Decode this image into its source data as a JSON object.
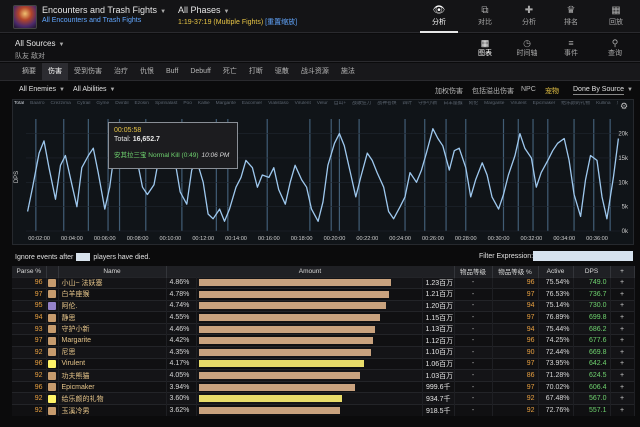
{
  "header": {
    "title": "Encounters and Trash Fights",
    "subtitle": "All Encounters and Trash Fights",
    "phase": "All Phases",
    "phase_time": "1:19-37:19 (Multiple Fights)",
    "phase_reset": "[重置缩放]",
    "tabs": [
      {
        "label": "分析",
        "icon": "eye-icon",
        "glyph": "👁"
      },
      {
        "label": "对比",
        "icon": "compare-icon",
        "glyph": "⧉"
      },
      {
        "label": "分析",
        "icon": "puzzle-icon",
        "glyph": "✚"
      },
      {
        "label": "排名",
        "icon": "trophy-icon",
        "glyph": "♛"
      },
      {
        "label": "回放",
        "icon": "replay-icon",
        "glyph": "▦"
      }
    ]
  },
  "sources": {
    "label": "All Sources",
    "sub": "队友  敌对"
  },
  "view_tabs": [
    {
      "label": "图表",
      "icon": "grid-icon",
      "glyph": "▦"
    },
    {
      "label": "时间轴",
      "icon": "clock-icon",
      "glyph": "◷"
    },
    {
      "label": "事件",
      "icon": "list-icon",
      "glyph": "≡"
    },
    {
      "label": "查询",
      "icon": "pin-icon",
      "glyph": "⚲"
    }
  ],
  "metric_tabs": [
    "摘要",
    "伤害",
    "受到伤害",
    "治疗",
    "仇恨",
    "Buff",
    "Debuff",
    "死亡",
    "打断",
    "驱散",
    "战斗资源",
    "施法"
  ],
  "filters": {
    "enemies": "All Enemies",
    "abilities": "All Abilities",
    "right": [
      "加权伤害",
      "包括溢出伤害",
      "NPC",
      "宠物"
    ],
    "done_by": "Done By Source"
  },
  "chart_legend": [
    "Total",
    "Baarro",
    "Crezzima",
    "Cytrail",
    "Gyme",
    "Dvirdil",
    "Ezosin",
    "Spirinalast",
    "Poo",
    "Kallie",
    "Margarite",
    "Eacomier",
    "Vialistaso",
    "Virulent",
    "Velur",
    "自山+",
    "战歌狂刀",
    "战神苍焕",
    "四叶",
    "守护小新",
    "白羊座猴",
    "阿伦",
    "Margarite",
    "Virulent",
    "Epicmaker",
    "给乐颜的礼物",
    "Kullina",
    "尼思",
    "大火黄猫",
    "太神",
    "小鸡",
    "Liadid",
    "Yeldam",
    "玉溪冷男",
    "Pooo",
    "Virulent",
    "功夫熊猫"
  ],
  "tooltip": {
    "time": "00:05:58",
    "total_label": "Total:",
    "total_value": "16,652.7",
    "event": "安其拉三宝 Normal Kill (0:49)",
    "event_time": "10:06 PM"
  },
  "chart_data": {
    "type": "line",
    "ylabel": "DPS",
    "yticks": [
      "0k",
      "5k",
      "10k",
      "15k",
      "20k"
    ],
    "ylim": [
      0,
      23000
    ],
    "xticks": [
      "00:02:00",
      "00:04:00",
      "00:06:00",
      "00:08:00",
      "00:10:00",
      "00:12:00",
      "00:14:00",
      "00:16:00",
      "00:18:00",
      "00:20:00",
      "00:22:00",
      "00:24:00",
      "00:26:00",
      "00:28:00",
      "00:30:00",
      "00:32:00",
      "00:34:00",
      "00:36:00"
    ],
    "xlim_min": [
      1.2,
      37.4
    ],
    "series": [
      {
        "name": "Total",
        "x_min": [
          1.3,
          1.6,
          2.0,
          2.3,
          2.6,
          3.0,
          3.3,
          3.6,
          4.0,
          4.3,
          4.6,
          5.0,
          5.3,
          5.6,
          6.0,
          6.3,
          6.6,
          7.0,
          7.3,
          7.6,
          8.0,
          8.3,
          8.6,
          9.0,
          9.3,
          9.6,
          10.0,
          10.3,
          10.6,
          11.0,
          11.3,
          11.6,
          12.0,
          12.3,
          12.6,
          13.0,
          13.3,
          13.6,
          14.0,
          14.3,
          14.6,
          15.0,
          15.3,
          15.6,
          16.0,
          16.3,
          16.6,
          17.0,
          17.3,
          17.6,
          18.0,
          18.3,
          18.6,
          19.0,
          19.3,
          19.6,
          20.0,
          20.3,
          20.6,
          21.0,
          21.3,
          21.6,
          22.0,
          22.3,
          22.6,
          23.0,
          23.3,
          23.6,
          24.0,
          24.3,
          24.6,
          25.0,
          25.3,
          25.6,
          26.0,
          26.3,
          26.6,
          27.0,
          27.3,
          27.6,
          28.0,
          28.3,
          28.6,
          29.0,
          29.3,
          29.6,
          30.0,
          30.3,
          30.6,
          31.0,
          31.3,
          31.6,
          32.0,
          32.3,
          32.6,
          33.0,
          33.3,
          33.6,
          34.0,
          34.3,
          34.6,
          35.0,
          35.3,
          35.6,
          36.0,
          36.3,
          36.6,
          37.0,
          37.3
        ],
        "y": [
          4000,
          9000,
          16000,
          18500,
          13000,
          6500,
          13500,
          15500,
          9500,
          5000,
          13000,
          15500,
          17000,
          12000,
          4500,
          9000,
          16500,
          15500,
          18500,
          15000,
          14000,
          9000,
          7500,
          9500,
          15000,
          17000,
          16000,
          14000,
          8000,
          5500,
          12500,
          14500,
          10000,
          3500,
          2500,
          4500,
          2000,
          4500,
          9000,
          11000,
          14500,
          13000,
          9000,
          11500,
          11000,
          13000,
          8500,
          5500,
          10000,
          13500,
          10500,
          9000,
          4500,
          2000,
          6000,
          13500,
          18000,
          20000,
          17500,
          11500,
          7000,
          11000,
          16000,
          14500,
          12000,
          9000,
          4000,
          2500,
          5000,
          7000,
          12000,
          10000,
          12500,
          16000,
          21000,
          19000,
          17500,
          12500,
          16500,
          17000,
          13000,
          7000,
          10500,
          14000,
          11500,
          7000,
          4500,
          7500,
          11500,
          15500,
          20000,
          17000,
          15000,
          9000,
          12000,
          14500,
          16500,
          18000,
          19000,
          14500,
          7500,
          3000,
          10500,
          15500,
          14500,
          7000,
          2500,
          11000,
          19000
        ]
      }
    ],
    "fight_markers_min": [
      1.8,
      3.5,
      5.0,
      6.2,
      6.9,
      8.5,
      10.7,
      12.8,
      13.5,
      15.9,
      18.5,
      19.8,
      20.3,
      21.5,
      24.3,
      25.5,
      26.8,
      28.0,
      30.3,
      31.2,
      32.1,
      33.0,
      34.6,
      35.8,
      36.8
    ]
  },
  "options": {
    "ignore_label": "Ignore events after",
    "ignore_suffix": "players have died.",
    "filter_label": "Filter Expression:",
    "filter_placeholder": ""
  },
  "table": {
    "columns": [
      "Parse %",
      "",
      "Name",
      "Amount",
      "",
      "物品等级",
      "物品等级 %",
      "Active",
      "DPS",
      "+"
    ],
    "rows": [
      {
        "parse": "96",
        "icon_color": "#c69b6d",
        "name": "小山~ 法妖塞",
        "pct": "4.86%",
        "bar": 0.87,
        "bar_color": "#c9a27e",
        "amount": "1.23百万",
        "ilvl": "-",
        "ilvl_pct": "96",
        "active": "75.54%",
        "dps": "749.0"
      },
      {
        "parse": "97",
        "icon_color": "#c69b6d",
        "name": "白羊座猴",
        "pct": "4.78%",
        "bar": 0.86,
        "bar_color": "#c9a27e",
        "amount": "1.21百万",
        "ilvl": "-",
        "ilvl_pct": "97",
        "active": "76.53%",
        "dps": "736.7"
      },
      {
        "parse": "95",
        "icon_color": "#9482c9",
        "name": "阿伦.",
        "pct": "4.74%",
        "bar": 0.85,
        "bar_color": "#c9a27e",
        "amount": "1.20百万",
        "ilvl": "-",
        "ilvl_pct": "94",
        "active": "75.14%",
        "dps": "730.0"
      },
      {
        "parse": "94",
        "icon_color": "#c69b6d",
        "name": "静思",
        "pct": "4.55%",
        "bar": 0.82,
        "bar_color": "#c9a27e",
        "amount": "1.15百万",
        "ilvl": "-",
        "ilvl_pct": "97",
        "active": "76.89%",
        "dps": "699.8"
      },
      {
        "parse": "93",
        "icon_color": "#c69b6d",
        "name": "守护小新",
        "pct": "4.46%",
        "bar": 0.8,
        "bar_color": "#c9a27e",
        "amount": "1.13百万",
        "ilvl": "-",
        "ilvl_pct": "94",
        "active": "75.44%",
        "dps": "686.2"
      },
      {
        "parse": "97",
        "icon_color": "#c69b6d",
        "name": "Margarite",
        "pct": "4.42%",
        "bar": 0.79,
        "bar_color": "#c9a27e",
        "amount": "1.12百万",
        "ilvl": "-",
        "ilvl_pct": "96",
        "active": "74.25%",
        "dps": "677.6"
      },
      {
        "parse": "92",
        "icon_color": "#c69b6d",
        "name": "尼思",
        "pct": "4.35%",
        "bar": 0.78,
        "bar_color": "#c9a27e",
        "amount": "1.10百万",
        "ilvl": "-",
        "ilvl_pct": "90",
        "active": "72.44%",
        "dps": "669.8"
      },
      {
        "parse": "96",
        "icon_color": "#fff468",
        "name": "Virulent",
        "pct": "4.17%",
        "bar": 0.75,
        "bar_color": "#e8dc6a",
        "amount": "1.06百万",
        "ilvl": "-",
        "ilvl_pct": "97",
        "active": "73.95%",
        "dps": "642.4"
      },
      {
        "parse": "92",
        "icon_color": "#c69b6d",
        "name": "功夫熊猫",
        "pct": "4.05%",
        "bar": 0.73,
        "bar_color": "#c9a27e",
        "amount": "1.03百万",
        "ilvl": "-",
        "ilvl_pct": "86",
        "active": "71.28%",
        "dps": "624.5"
      },
      {
        "parse": "96",
        "icon_color": "#c69b6d",
        "name": "Epicmaker",
        "pct": "3.94%",
        "bar": 0.71,
        "bar_color": "#c9a27e",
        "amount": "999.6千",
        "ilvl": "-",
        "ilvl_pct": "97",
        "active": "70.02%",
        "dps": "606.4"
      },
      {
        "parse": "92",
        "icon_color": "#fff468",
        "name": "给乐颜的礼物",
        "pct": "3.60%",
        "bar": 0.65,
        "bar_color": "#e8dc6a",
        "amount": "934.7千",
        "ilvl": "-",
        "ilvl_pct": "92",
        "active": "67.48%",
        "dps": "567.0"
      },
      {
        "parse": "92",
        "icon_color": "#c69b6d",
        "name": "玉溪冷男",
        "pct": "3.62%",
        "bar": 0.64,
        "bar_color": "#c9a27e",
        "amount": "918.5千",
        "ilvl": "-",
        "ilvl_pct": "92",
        "active": "72.76%",
        "dps": "557.1"
      }
    ]
  }
}
